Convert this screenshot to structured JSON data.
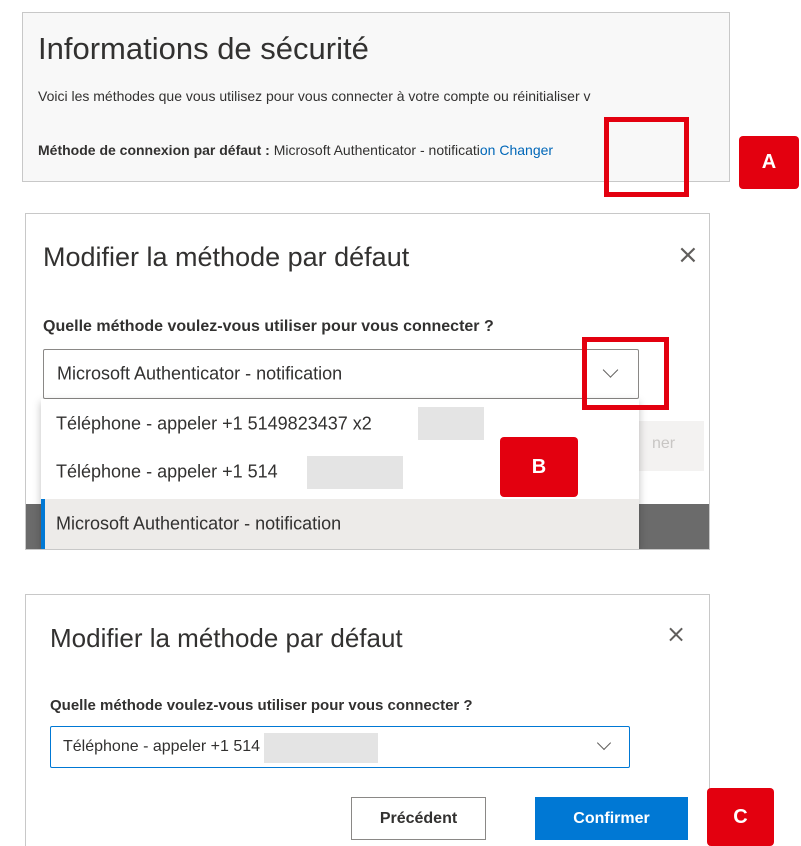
{
  "security_info": {
    "title": "Informations de sécurité",
    "description": "Voici les méthodes que vous utilisez pour vous connecter à votre compte ou réinitialiser v",
    "default_method_label": "Méthode de connexion par défaut :",
    "default_method_value": "Microsoft Authenticator - notificati",
    "change_link": "on Changer"
  },
  "dialog_open": {
    "title": "Modifier la méthode par défaut",
    "close_icon": "×",
    "question": "Quelle méthode voulez-vous utiliser pour vous connecter ?",
    "selected_value": "Microsoft Authenticator - notification",
    "options": [
      {
        "label": "Téléphone - appeler +1 5149823437 x2",
        "redacted": true
      },
      {
        "label": "Téléphone - appeler +1 514",
        "redacted": true
      },
      {
        "label": "Microsoft Authenticator - notification",
        "selected": true
      }
    ],
    "obscured_button_label": "ner"
  },
  "dialog_confirm": {
    "title": "Modifier la méthode par défaut",
    "close_icon": "×",
    "question": "Quelle méthode voulez-vous utiliser pour vous connecter ?",
    "selected_value": "Téléphone - appeler +1 514",
    "previous_label": "Précédent",
    "confirm_label": "Confirmer"
  },
  "annotations": {
    "a": "A",
    "b": "B",
    "c": "C",
    "color": "#e3000f"
  },
  "colors": {
    "accent": "#0078d4",
    "link": "#0067b8",
    "text": "#323130"
  }
}
